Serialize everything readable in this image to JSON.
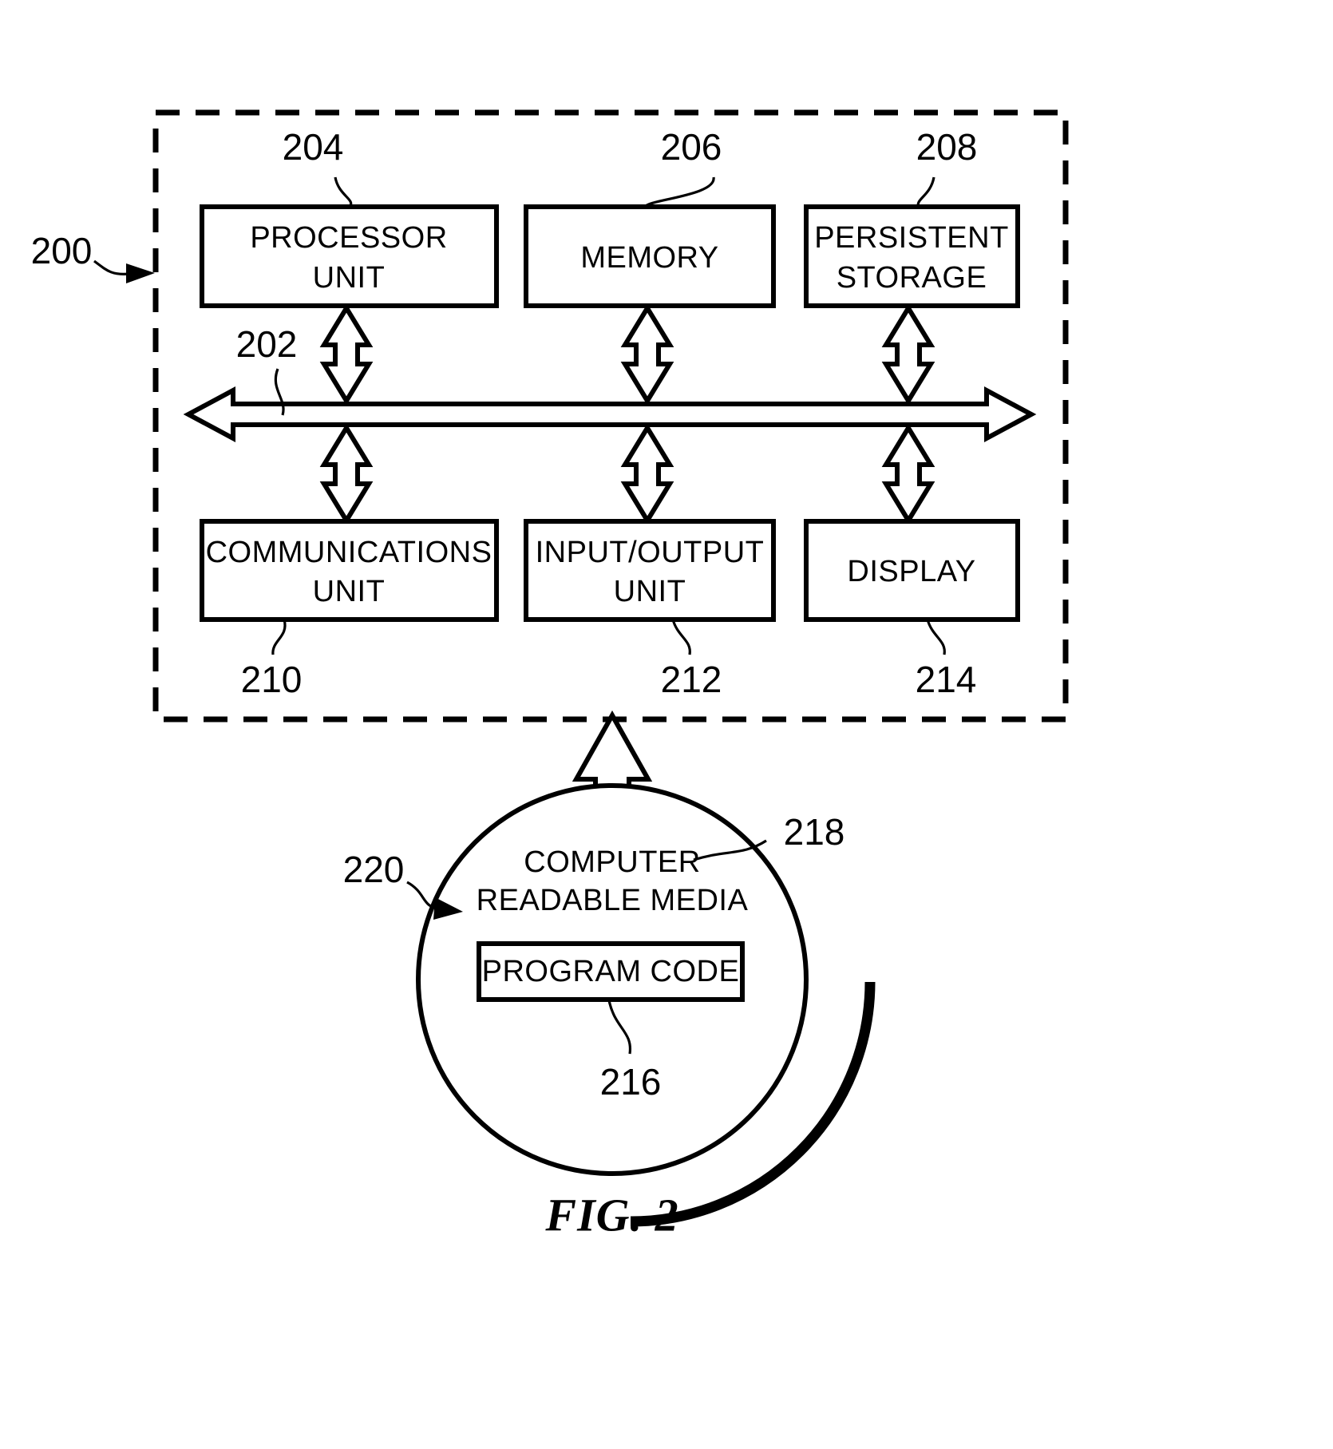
{
  "figure": {
    "caption": "FIG. 2",
    "system_ref": "200",
    "bus_ref": "202"
  },
  "blocks": {
    "top_row": [
      {
        "id": "processor-unit",
        "line1": "PROCESSOR",
        "line2": "UNIT",
        "ref": "204"
      },
      {
        "id": "memory",
        "line1": "MEMORY",
        "line2": "",
        "ref": "206"
      },
      {
        "id": "persistent-storage",
        "line1": "PERSISTENT",
        "line2": "STORAGE",
        "ref": "208"
      }
    ],
    "bottom_row": [
      {
        "id": "communications-unit",
        "line1": "COMMUNICATIONS",
        "line2": "UNIT",
        "ref": "210"
      },
      {
        "id": "input-output-unit",
        "line1": "INPUT/OUTPUT",
        "line2": "UNIT",
        "ref": "212"
      },
      {
        "id": "display",
        "line1": "DISPLAY",
        "line2": "",
        "ref": "214"
      }
    ]
  },
  "media": {
    "label_line1": "COMPUTER",
    "label_line2": "READABLE MEDIA",
    "media_ref": "218",
    "assembly_ref": "220",
    "program_code_label": "PROGRAM CODE",
    "program_code_ref": "216"
  },
  "colors": {
    "ink": "#000000",
    "paper": "#ffffff"
  },
  "icons": {
    "bus_arrow": "double-headed-horizontal-arrow",
    "link_arrow": "double-headed-vertical-arrow",
    "media_arrow": "up-arrow",
    "leader_pointer": "solid-arrowhead"
  }
}
